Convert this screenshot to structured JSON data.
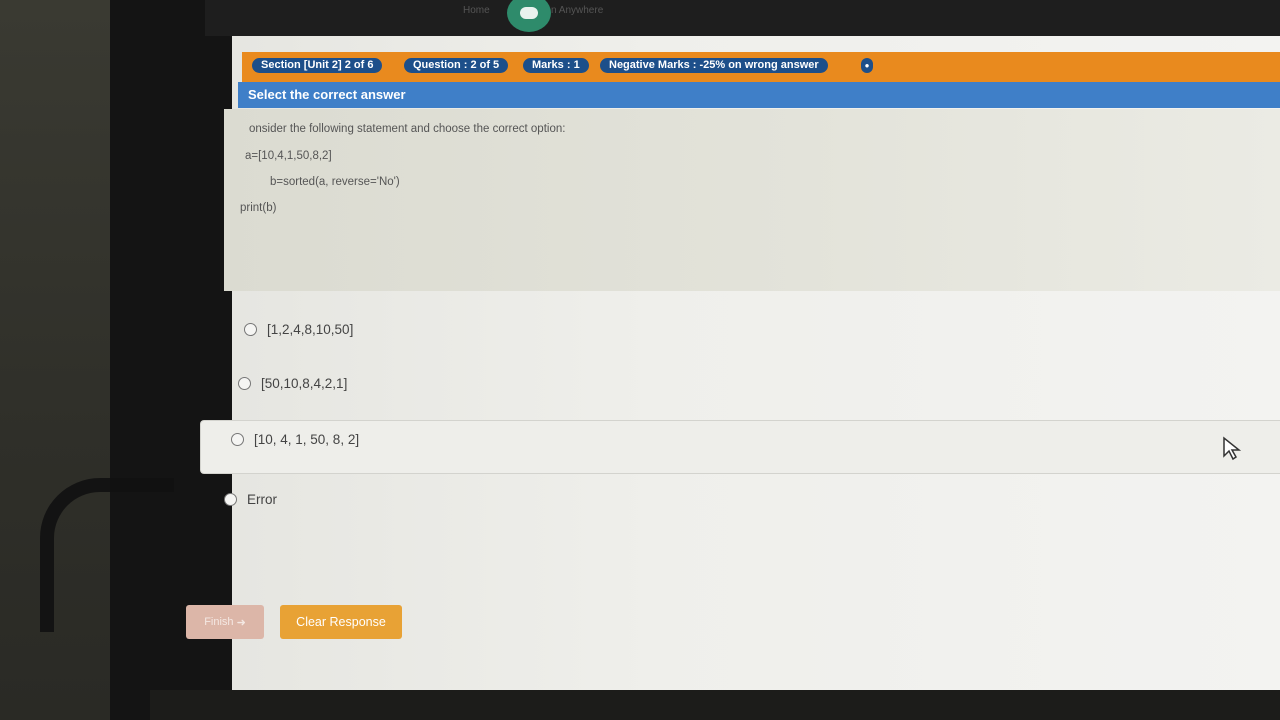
{
  "browser": {
    "home_label": "Home",
    "anywhere_label": "n Anywhere"
  },
  "header": {
    "section": "Section [Unit 2] 2 of 6",
    "question": "Question : 2 of 5",
    "marks": "Marks : 1",
    "negative": "Negative Marks : -25% on wrong answer"
  },
  "instruction": "Select the correct answer",
  "question_lines": [
    "onsider the following statement and choose the correct option:",
    "a=[10,4,1,50,8,2]",
    "b=sorted(a, reverse='No')",
    "print(b)"
  ],
  "options": [
    {
      "label": "[1,2,4,8,10,50]"
    },
    {
      "label": "[50,10,8,4,2,1]"
    },
    {
      "label": "[10, 4, 1, 50, 8, 2]"
    },
    {
      "label": "Error"
    }
  ],
  "buttons": {
    "finish": "Finish",
    "clear": "Clear Response"
  },
  "colors": {
    "orange_bar": "#e98a1e",
    "pill": "#1d4f8a",
    "instruction_bar": "#3f7fc8",
    "clear_button": "#e8a235",
    "finish_button": "#dcb6a8"
  }
}
